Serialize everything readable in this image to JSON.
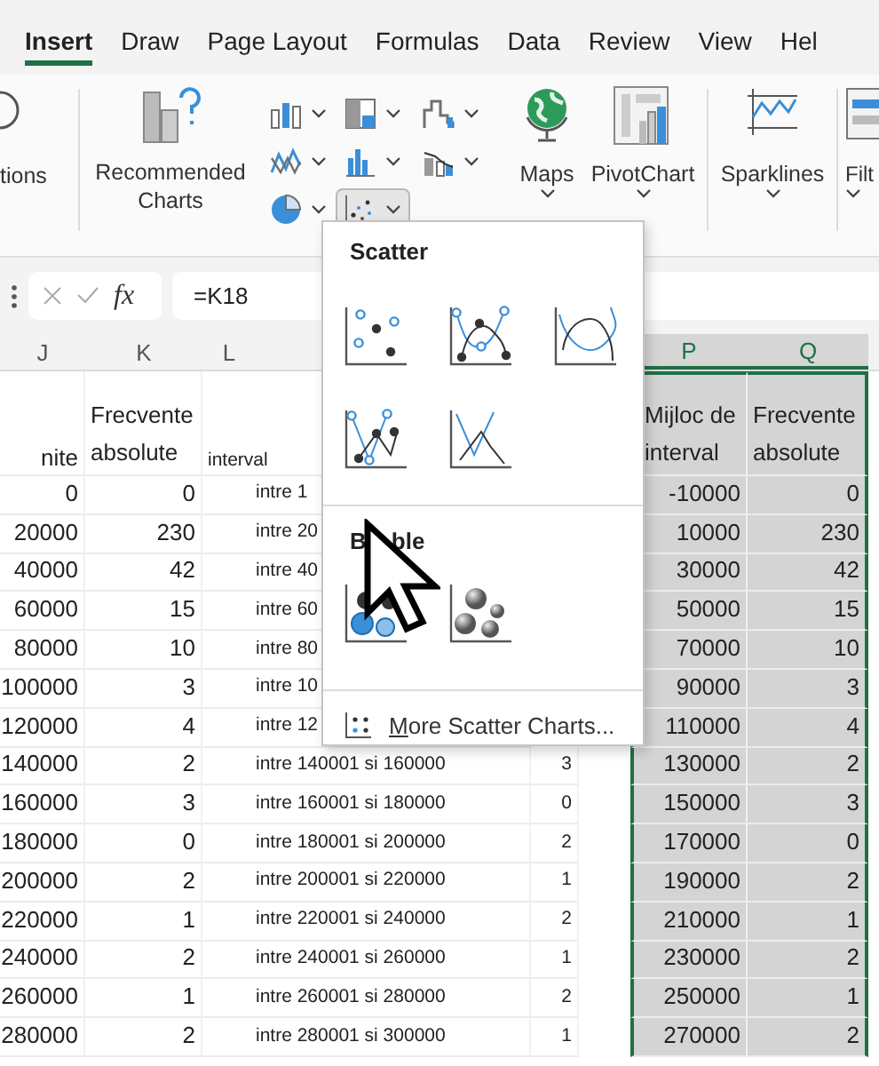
{
  "tabs": [
    {
      "label": "Insert",
      "selected": true
    },
    {
      "label": "Draw",
      "selected": false
    },
    {
      "label": "Page Layout",
      "selected": false
    },
    {
      "label": "Formulas",
      "selected": false
    },
    {
      "label": "Data",
      "selected": false
    },
    {
      "label": "Review",
      "selected": false
    },
    {
      "label": "View",
      "selected": false
    },
    {
      "label": "Hel",
      "selected": false
    }
  ],
  "ribbon": {
    "partial_group": "tions",
    "recommended": [
      "Recommended",
      "Charts"
    ],
    "chart_buttons": [
      {
        "kind": "column",
        "selected": false
      },
      {
        "kind": "hierarchy",
        "selected": false
      },
      {
        "kind": "waterfall",
        "selected": false
      },
      {
        "kind": "line",
        "selected": false
      },
      {
        "kind": "statistic",
        "selected": false
      },
      {
        "kind": "combo",
        "selected": false
      },
      {
        "kind": "pie",
        "selected": false
      },
      {
        "kind": "scatter",
        "selected": true
      }
    ],
    "maps": "Maps",
    "pivot": "PivotChart",
    "sparklines": "Sparklines",
    "filters": "Filt"
  },
  "formula_bar": {
    "function_label": "fx",
    "value": "=K18"
  },
  "columns": [
    "J",
    "K",
    "L",
    "P",
    "Q"
  ],
  "sheet": {
    "header": {
      "j": "nite",
      "k": "Frecvente absolute",
      "l": "interval",
      "p": "Mijloc de interval",
      "q": "Frecvente absolute"
    },
    "rows": [
      {
        "j": "0",
        "k": "0",
        "l": "intre 1",
        "p": "-10000",
        "q": "0"
      },
      {
        "j": "20000",
        "k": "230",
        "l": "intre 20",
        "p": "10000",
        "q": "230"
      },
      {
        "j": "40000",
        "k": "42",
        "l": "intre 40",
        "p": "30000",
        "q": "42"
      },
      {
        "j": "60000",
        "k": "15",
        "l": "intre 60",
        "p": "50000",
        "q": "15"
      },
      {
        "j": "80000",
        "k": "10",
        "l": "intre 80",
        "p": "70000",
        "q": "10"
      },
      {
        "j": "100000",
        "k": "3",
        "l": "intre 10",
        "p": "90000",
        "q": "3"
      },
      {
        "j": "120000",
        "k": "4",
        "l": "intre 12",
        "p": "110000",
        "q": "4"
      },
      {
        "j": "140000",
        "k": "2",
        "l": "intre 140001 si 160000",
        "m": "3",
        "p": "130000",
        "q": "2"
      },
      {
        "j": "160000",
        "k": "3",
        "l": "intre 160001 si 180000",
        "m": "0",
        "p": "150000",
        "q": "3"
      },
      {
        "j": "180000",
        "k": "0",
        "l": "intre 180001 si 200000",
        "m": "2",
        "p": "170000",
        "q": "0"
      },
      {
        "j": "200000",
        "k": "2",
        "l": "intre 200001 si 220000",
        "m": "1",
        "p": "190000",
        "q": "2"
      },
      {
        "j": "220000",
        "k": "1",
        "l": "intre 220001 si 240000",
        "m": "2",
        "p": "210000",
        "q": "1"
      },
      {
        "j": "240000",
        "k": "2",
        "l": "intre 240001 si 260000",
        "m": "1",
        "p": "230000",
        "q": "2"
      },
      {
        "j": "260000",
        "k": "1",
        "l": "intre 260001 si 280000",
        "m": "2",
        "p": "250000",
        "q": "1"
      },
      {
        "j": "280000",
        "k": "2",
        "l": "intre 280001 si 300000",
        "m": "1",
        "p": "270000",
        "q": "2"
      }
    ]
  },
  "menu": {
    "sections": [
      {
        "title_parts": [
          "Scatter"
        ],
        "items": [
          {
            "kind": "markers"
          },
          {
            "kind": "smooth-markers"
          },
          {
            "kind": "smooth"
          },
          {
            "kind": "straight-markers"
          },
          {
            "kind": "straight"
          }
        ]
      },
      {
        "title_parts": [
          "B",
          "ble"
        ],
        "items": [
          {
            "kind": "bubble"
          },
          {
            "kind": "bubble-3d"
          }
        ]
      }
    ],
    "more": "More Scatter Charts..."
  }
}
